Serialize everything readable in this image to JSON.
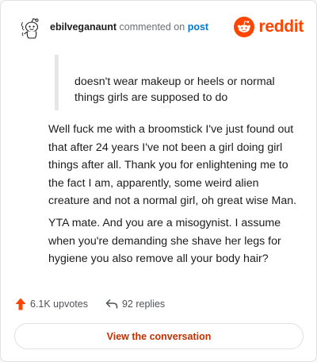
{
  "header": {
    "username": "ebilveganaunt",
    "verb": "commented on",
    "post_link": "post",
    "brand": "reddit",
    "brand_color": "#ff4500",
    "avatar_icon": "snoo-avatar-icon",
    "logo_icon": "reddit-alien-icon"
  },
  "comment": {
    "quote_lines": [
      "doesn't wear makeup or heels or normal",
      "things girls are supposed to do"
    ],
    "paragraph1_lines": [
      "Well fuck me with a broomstick I've just found out",
      "that after 24 years I've not been a girl doing girl",
      "things after all. Thank you for enlightening me to",
      "the fact I am, apparently, some weird alien",
      "creature and not a normal girl, oh great wise Man."
    ],
    "paragraph2_lines": [
      "YTA mate. And you are a misogynist. I assume",
      "when you're demanding she shave her legs for",
      "hygiene you also remove all your body hair?"
    ]
  },
  "footer": {
    "upvotes": "6.1K upvotes",
    "replies": "92 replies",
    "upvote_icon": "upvote-arrow-icon",
    "reply_icon": "reply-arrow-icon",
    "upvote_color": "#ff4500",
    "button_label": "View the conversation",
    "button_color": "#c13100"
  }
}
